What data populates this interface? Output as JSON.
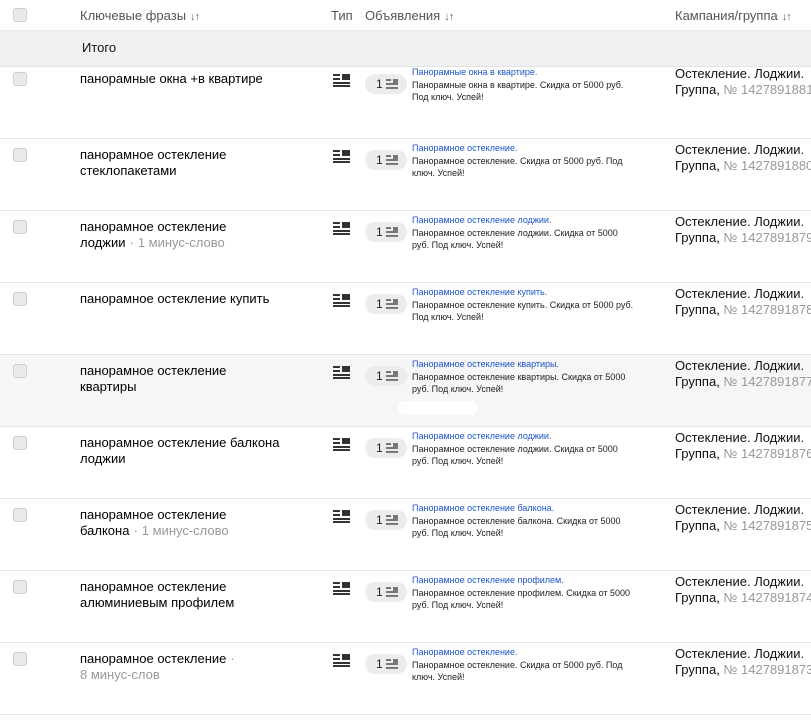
{
  "header": {
    "keywords_label": "Ключевые фразы",
    "type_label": "Тип",
    "ads_label": "Объявления",
    "campaign_label": "Кампания/группа",
    "sort_glyph": "↓↑"
  },
  "total": {
    "label": "Итого"
  },
  "campaign_prefix": "Остеклениe. Лоджии.",
  "group_prefix": "Группа, №",
  "rows": [
    {
      "kw": "панорамные окна +в квартире",
      "kw2": "",
      "minus": "",
      "count": "1",
      "ad_title": "Панорамные окна в квартире.",
      "ad_text": "Панорамные окна в квартире. Скидка от 5000 руб. Под ключ. Успей!",
      "campaign": "Остекление. Лоджии.",
      "group_label": "Группа,",
      "group_num": "№ 1427891881"
    },
    {
      "kw": "панорамное остекление",
      "kw2": "стеклопакетами",
      "minus": "",
      "count": "1",
      "ad_title": "Панорамное остекление.",
      "ad_text": "Панорамное остекление. Скидка от 5000 руб. Под ключ. Успей!",
      "campaign": "Остекление. Лоджии.",
      "group_label": "Группа,",
      "group_num": "№ 1427891880"
    },
    {
      "kw": "панорамное остекление",
      "kw2": "лоджии",
      "minus": "1 минус-слово",
      "count": "1",
      "ad_title": "Панорамное остекление лоджии.",
      "ad_text": "Панорамное остекление лоджии. Скидка от 5000 руб. Под ключ. Успей!",
      "campaign": "Остекление. Лоджии.",
      "group_label": "Группа,",
      "group_num": "№ 1427891879"
    },
    {
      "kw": "панорамное остекление купить",
      "kw2": "",
      "minus": "",
      "count": "1",
      "ad_title": "Панорамное остекление купить.",
      "ad_text": "Панорамное остекление купить. Скидка от 5000 руб. Под ключ. Успей!",
      "campaign": "Остекление. Лоджии.",
      "group_label": "Группа,",
      "group_num": "№ 1427891878"
    },
    {
      "kw": "панорамное остекление",
      "kw2": "квартиры",
      "minus": "",
      "count": "1",
      "ad_title": "Панорамное остекление квартиры.",
      "ad_text": "Панорамное остекление квартиры. Скидка от 5000 руб. Под ключ. Успей!",
      "campaign": "Остекление. Лоджии.",
      "group_label": "Группа,",
      "group_num": "№ 1427891877"
    },
    {
      "kw": "панорамное остекление балкона",
      "kw2": "лоджии",
      "minus": "",
      "count": "1",
      "ad_title": "Панорамное остекление лоджии.",
      "ad_text": "Панорамное остекление лоджии. Скидка от 5000 руб. Под ключ. Успей!",
      "campaign": "Остекление. Лоджии.",
      "group_label": "Группа,",
      "group_num": "№ 1427891876"
    },
    {
      "kw": "панорамное остекление",
      "kw2": "балкона",
      "minus": "1 минус-слово",
      "count": "1",
      "ad_title": "Панорамное остекление балкона.",
      "ad_text": "Панорамное остекление балкона. Скидка от 5000 руб. Под ключ. Успей!",
      "campaign": "Остекление. Лоджии.",
      "group_label": "Группа,",
      "group_num": "№ 1427891875"
    },
    {
      "kw": "панорамное остекление",
      "kw2": "алюминиевым профилем",
      "minus": "",
      "count": "1",
      "ad_title": "Панорамное остекление профилем.",
      "ad_text": "Панорамное остекление профилем. Скидка от 5000 руб. Под ключ. Успей!",
      "campaign": "Остекление. Лоджии.",
      "group_label": "Группа,",
      "group_num": "№ 1427891874"
    },
    {
      "kw": "панорамное остекление",
      "kw2": "",
      "minus": "8 минус-слов",
      "count": "1",
      "ad_title": "Панорамное остекление.",
      "ad_text": "Панорамное остекление. Скидка от 5000 руб. Под ключ. Успей!",
      "campaign": "Остекление. Лоджии.",
      "group_label": "Группа,",
      "group_num": "№ 1427891873"
    }
  ]
}
